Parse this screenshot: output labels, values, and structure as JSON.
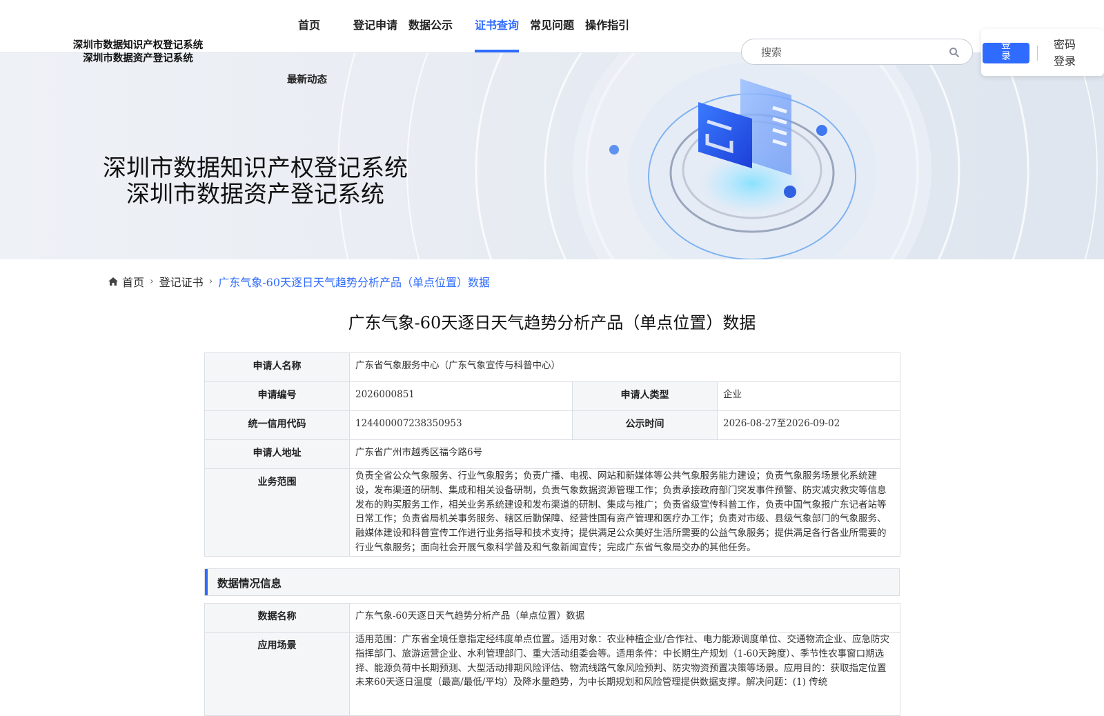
{
  "header": {
    "logo_line1": "深圳市数据知识产权登记系统",
    "logo_line2": "深圳市数据资产登记系统",
    "nav": [
      "首页",
      "登记申请",
      "数据公示",
      "证书查询",
      "常见问题",
      "操作指引"
    ],
    "active_nav": "证书查询",
    "sub_nav": "最新动态",
    "search_placeholder": "搜索",
    "login_label": "登录",
    "login_line1": "登",
    "login_line2": "录",
    "pwd_login_line1": "密码",
    "pwd_login_line2": "登录"
  },
  "banner": {
    "title_line1": "深圳市数据知识产权登记系统",
    "title_line2": "深圳市数据资产登记系统"
  },
  "breadcrumb": {
    "home": "首页",
    "level2": "登记证书",
    "current": "广东气象-60天逐日天气趋势分析产品（单点位置）数据"
  },
  "page_title": "广东气象-60天逐日天气趋势分析产品（单点位置）数据",
  "applicant": {
    "name_label": "申请人名称",
    "name_value": "广东省气象服务中心（广东气象宣传与科普中心）",
    "no_label": "申请编号",
    "no_value": "2026000851",
    "type_label": "申请人类型",
    "type_value": "企业",
    "code_label": "统一信用代码",
    "code_value": "124400007238350953",
    "time_label": "公示时间",
    "time_value": "2026-08-27至2026-09-02",
    "addr_label": "申请人地址",
    "addr_value": "广东省广州市越秀区福今路6号",
    "scope_label": "业务范围",
    "scope_value": "负责全省公众气象服务、行业气象服务；负责广播、电视、网站和新媒体等公共气象服务能力建设；负责气象服务场景化系统建设，发布渠道的研制、集成和相关设备研制，负责气象数据资源管理工作；负责承接政府部门突发事件预警、防灾减灾救灾等信息发布的购买服务工作，相关业务系统建设和发布渠道的研制、集成与推广；负责省级宣传科普工作，负责中国气象报广东记者站等日常工作；负责省局机关事务服务、辖区后勤保障、经营性国有资产管理和医疗办工作；负责对市级、县级气象部门的气象服务、融媒体建设和科普宣传工作进行业务指导和技术支持；提供满足公众美好生活所需要的公益气象服务；提供满足各行各业所需要的行业气象服务；面向社会开展气象科学普及和气象新闻宣传；完成广东省气象局交办的其他任务。"
  },
  "data_section": {
    "title": "数据情况信息",
    "name_label": "数据名称",
    "name_value": "广东气象-60天逐日天气趋势分析产品（单点位置）数据",
    "scene_label": "应用场景",
    "scene_value": "适用范围：广东省全境任意指定经纬度单点位置。适用对象：农业种植企业/合作社、电力能源调度单位、交通物流企业、应急防灾指挥部门、旅游运营企业、水利管理部门、重大活动组委会等。适用条件：中长期生产规划（1-60天跨度）、季节性农事窗口期选择、能源负荷中长期预测、大型活动排期风险评估、物流线路气象风险预判、防灾物资预置决策等场景。应用目的：获取指定位置未来60天逐日温度（最高/最低/平均）及降水量趋势，为中长期规划和风险管理提供数据支撑。解决问题：(1) 传统"
  },
  "colors": {
    "accent": "#2f6bff",
    "label_bg": "#f5f6f8",
    "border": "#dadde3"
  },
  "icons": [
    "search-icon",
    "home-icon",
    "chevron-right-icon"
  ]
}
